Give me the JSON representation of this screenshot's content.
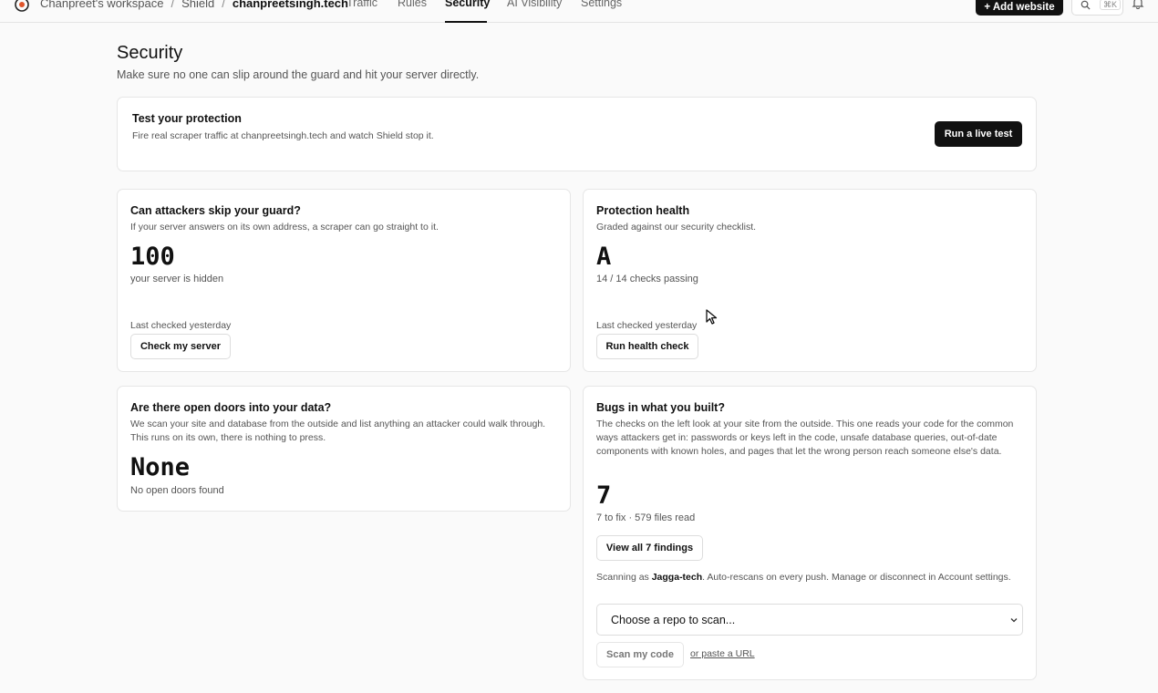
{
  "breadcrumb": {
    "workspace": "Chanpreet's workspace",
    "product": "Shield",
    "site": "chanpreetsingh.tech"
  },
  "nav": {
    "traffic": "Traffic",
    "rules": "Rules",
    "security": "Security",
    "ai_visibility": "AI Visibility",
    "settings": "Settings",
    "active": "Security"
  },
  "header_actions": {
    "add_website": "+ Add website",
    "search_shortcut": "⌘K"
  },
  "page": {
    "title": "Security",
    "subtitle": "Make sure no one can slip around the guard and hit your server directly."
  },
  "test_protection": {
    "title": "Test your protection",
    "description": "Fire real scraper traffic at chanpreetsingh.tech and watch Shield stop it.",
    "button": "Run a live test"
  },
  "skip_guard": {
    "title": "Can attackers skip your guard?",
    "description": "If your server answers on its own address, a scraper can go straight to it.",
    "score": "100",
    "caption": "your server is hidden",
    "last_checked": "Last checked yesterday",
    "button": "Check my server"
  },
  "health": {
    "title": "Protection health",
    "description": "Graded against our security checklist.",
    "grade": "A",
    "caption": "14 / 14 checks passing",
    "last_checked": "Last checked yesterday",
    "button": "Run health check"
  },
  "open_doors": {
    "title": "Are there open doors into your data?",
    "description": "We scan your site and database from the outside and list anything an attacker could walk through. This runs on its own, there is nothing to press.",
    "value": "None",
    "caption": "No open doors found"
  },
  "bugs": {
    "title": "Bugs in what you built?",
    "description": "The checks on the left look at your site from the outside. This one reads your code for the common ways attackers get in: passwords or keys left in the code, unsafe database queries, out-of-date components with known holes, and pages that let the wrong person reach someone else's data.",
    "count": "7",
    "caption": "7 to fix · 579 files read",
    "button": "View all 7 findings",
    "scanning_prefix": "Scanning as ",
    "scanning_user": "Jagga-tech",
    "scanning_suffix": ". Auto-rescans on every push. Manage or disconnect in Account settings.",
    "repo_placeholder": "Choose a repo to scan...",
    "scan_button": "Scan my code",
    "paste_url": "or paste a URL"
  }
}
